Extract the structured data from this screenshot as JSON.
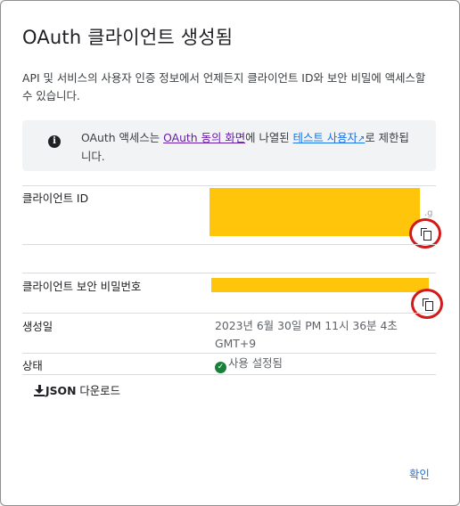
{
  "dialog": {
    "title": "OAuth 클라이언트 생성됨",
    "description": "API 및 서비스의 사용자 인증 정보에서 언제든지 클라이언트 ID와 보안 비밀에 액세스할 수 있습니다.",
    "info": {
      "prefix": "OAuth 액세스는 ",
      "consent_link": "OAuth 동의 화면",
      "middle": "에 나열된 ",
      "test_users_link": "테스트 사용자",
      "suffix": "로 제한됩니다."
    },
    "client_id_label": "클라이언트 ID",
    "client_secret_label": "클라이언트 보안 비밀번호",
    "created_label": "생성일",
    "created_value": "2023년 6월 30일 PM 11시 36분 4초 GMT+9",
    "status_label": "상태",
    "status_value": "사용 설정됨",
    "json_download_bold": "JSON",
    "json_download_rest": " 다운로드",
    "confirm_label": "확인"
  },
  "colors": {
    "redaction": "#ffc50b",
    "annotation_circle": "#d11a1a",
    "link_visited": "#681da8",
    "link": "#1a73e8",
    "status_green": "#188038"
  },
  "icons": [
    "info-icon",
    "external-link-icon",
    "copy-icon",
    "check-circle-icon",
    "download-icon"
  ]
}
